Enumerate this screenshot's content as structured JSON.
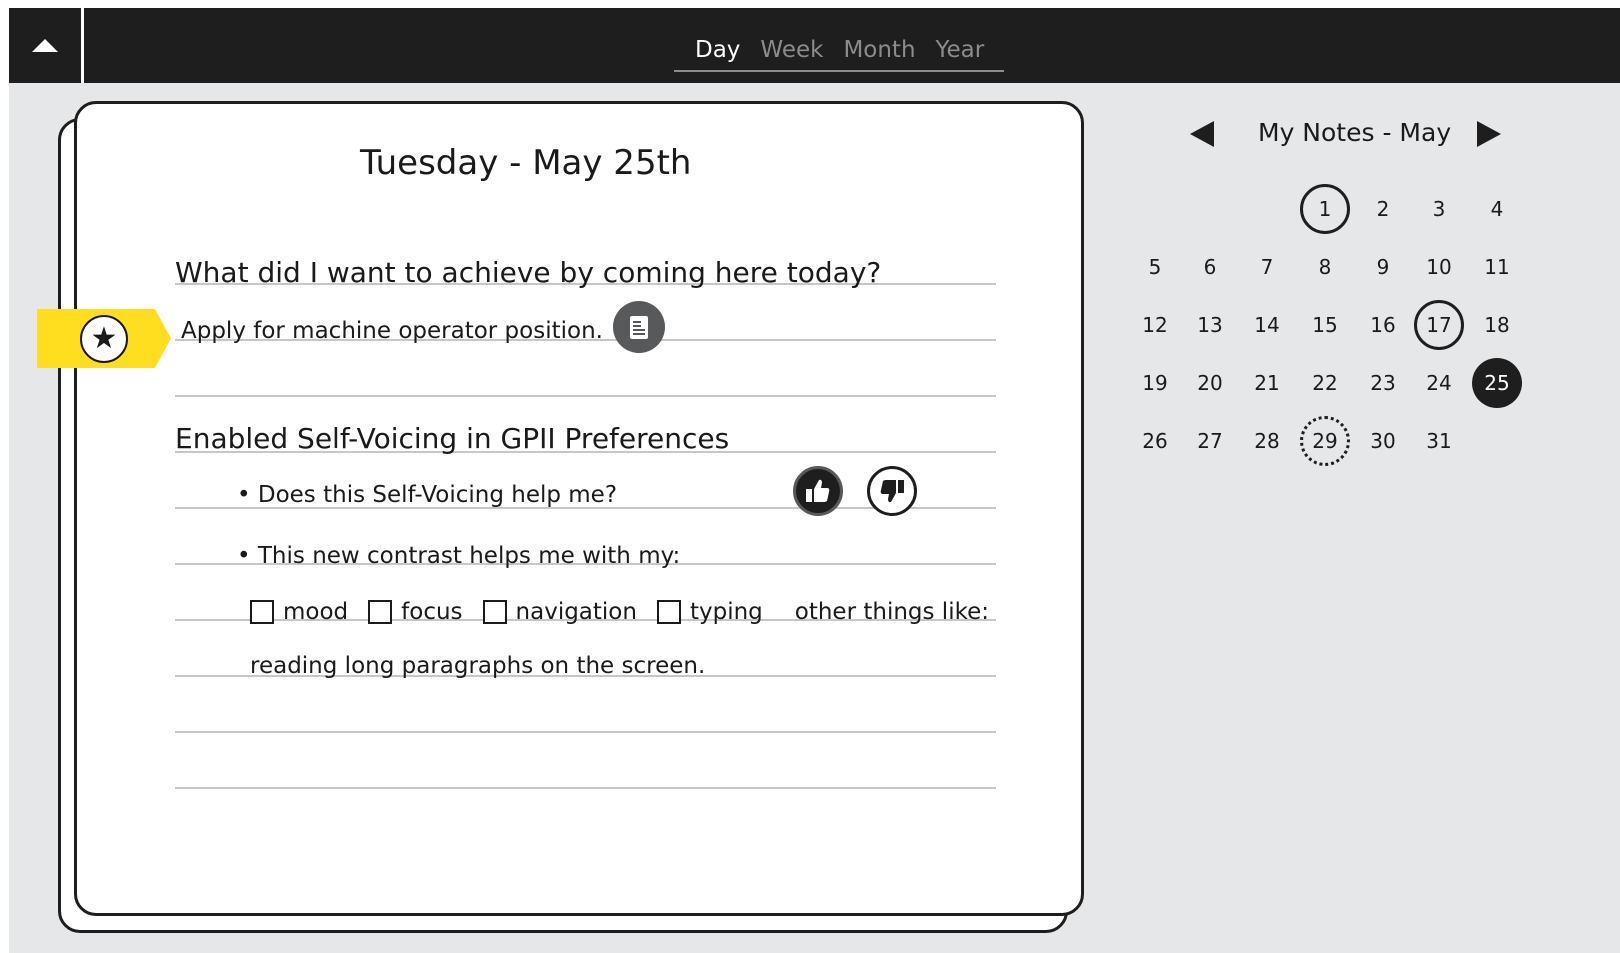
{
  "topbar": {
    "collapse_icon": "triangle-up-icon",
    "tabs": [
      {
        "label": "Day",
        "active": true
      },
      {
        "label": "Week",
        "active": false
      },
      {
        "label": "Month",
        "active": false
      },
      {
        "label": "Year",
        "active": false
      }
    ]
  },
  "page": {
    "title": "Tuesday - May 25th",
    "question": "What did I want to achieve by coming here today?",
    "goal_text": "Apply for machine operator position.",
    "bookmark_icon": "star-icon",
    "note_icon": "document-icon",
    "section_heading": "Enabled Self-Voicing in GPII Preferences",
    "bullet1": "• Does this Self-Voicing help me?",
    "bullet2": "• This new contrast helps me with my:",
    "checkboxes": [
      {
        "label": "mood",
        "checked": false
      },
      {
        "label": "focus",
        "checked": false
      },
      {
        "label": "navigation",
        "checked": false
      },
      {
        "label": "typing",
        "checked": false
      }
    ],
    "other_label": "other things like:",
    "other_value": "reading long paragraphs on the screen.",
    "thumbs_up_icon": "thumbs-up-icon",
    "thumbs_down_icon": "thumbs-down-icon"
  },
  "calendar": {
    "title": "My Notes - May",
    "prev_icon": "triangle-left-icon",
    "next_icon": "triangle-right-icon",
    "weeks": [
      [
        "",
        "",
        "",
        "1",
        "2",
        "3",
        "4"
      ],
      [
        "5",
        "6",
        "7",
        "8",
        "9",
        "10",
        "11"
      ],
      [
        "12",
        "13",
        "14",
        "15",
        "16",
        "17",
        "18"
      ],
      [
        "19",
        "20",
        "21",
        "22",
        "23",
        "24",
        "25"
      ],
      [
        "26",
        "27",
        "28",
        "29",
        "30",
        "31",
        ""
      ]
    ],
    "ringed_days": [
      "1",
      "17"
    ],
    "selected_day": "25",
    "dotted_days": [
      "29"
    ],
    "colors": {
      "dark": "#1e1e1e",
      "bookmark": "#ffdd1f",
      "background": "#e6e7e8"
    }
  }
}
